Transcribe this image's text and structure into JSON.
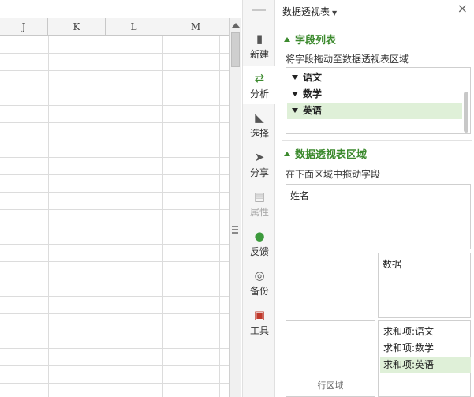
{
  "sheet": {
    "columns": [
      "J",
      "K",
      "L",
      "M"
    ]
  },
  "sidebar": {
    "tools": [
      {
        "id": "new",
        "label": "新建",
        "icon": "new-icon",
        "glyph": "▮",
        "color": "#555555"
      },
      {
        "id": "analyze",
        "label": "分析",
        "icon": "analyze-icon",
        "glyph": "⇄",
        "color": "#3c8a2e"
      },
      {
        "id": "select",
        "label": "选择",
        "icon": "select-icon",
        "glyph": "◣",
        "color": "#555555"
      },
      {
        "id": "share",
        "label": "分享",
        "icon": "share-icon",
        "glyph": "➤",
        "color": "#555555"
      },
      {
        "id": "properties",
        "label": "属性",
        "icon": "properties-icon",
        "glyph": "▤",
        "color": "#aaaaaa"
      },
      {
        "id": "feedback",
        "label": "反馈",
        "icon": "feedback-icon",
        "glyph": "●",
        "color": "#3c9a3c"
      },
      {
        "id": "backup",
        "label": "备份",
        "icon": "backup-icon",
        "glyph": "◎",
        "color": "#555555"
      },
      {
        "id": "tools",
        "label": "工具",
        "icon": "toolbox-icon",
        "glyph": "▣",
        "color": "#c0392b"
      }
    ]
  },
  "panel": {
    "title": "数据透视表",
    "close": "×",
    "field_section_title": "字段列表",
    "field_hint": "将字段拖动至数据透视表区域",
    "fields": [
      "语文",
      "数学",
      "英语"
    ],
    "area_section_title": "数据透视表区域",
    "area_hint": "在下面区域中拖动字段",
    "column_zone_item": "姓名",
    "data_zone_label": "数据",
    "row_zone_label": "行区域",
    "value_items": [
      "求和项:语文",
      "求和项:数学",
      "求和项:英语"
    ]
  },
  "colors": {
    "accent": "#3c8a2e",
    "selection": "#dff0d8"
  }
}
